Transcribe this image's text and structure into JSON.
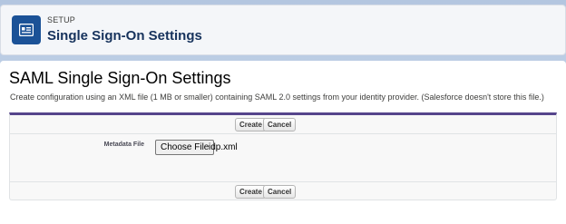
{
  "header": {
    "eyebrow": "SETUP",
    "title": "Single Sign-On Settings",
    "icon": "setup-card-icon"
  },
  "main": {
    "heading": "SAML Single Sign-On Settings",
    "description": "Create configuration using an XML file (1 MB or smaller) containing SAML 2.0 settings from your identity provider. (Salesforce doesn't store this file.)"
  },
  "form": {
    "top_buttons": {
      "create": "Create",
      "cancel": "Cancel"
    },
    "bottom_buttons": {
      "create": "Create",
      "cancel": "Cancel"
    },
    "metadata_label": "Metadata File",
    "choose_file_label": "Choose File",
    "selected_file": "idp.xml"
  },
  "colors": {
    "accent_bar": "#56458c",
    "icon_bg": "#1b5297",
    "title": "#16325c",
    "page_bg": "#b3c6e0"
  }
}
